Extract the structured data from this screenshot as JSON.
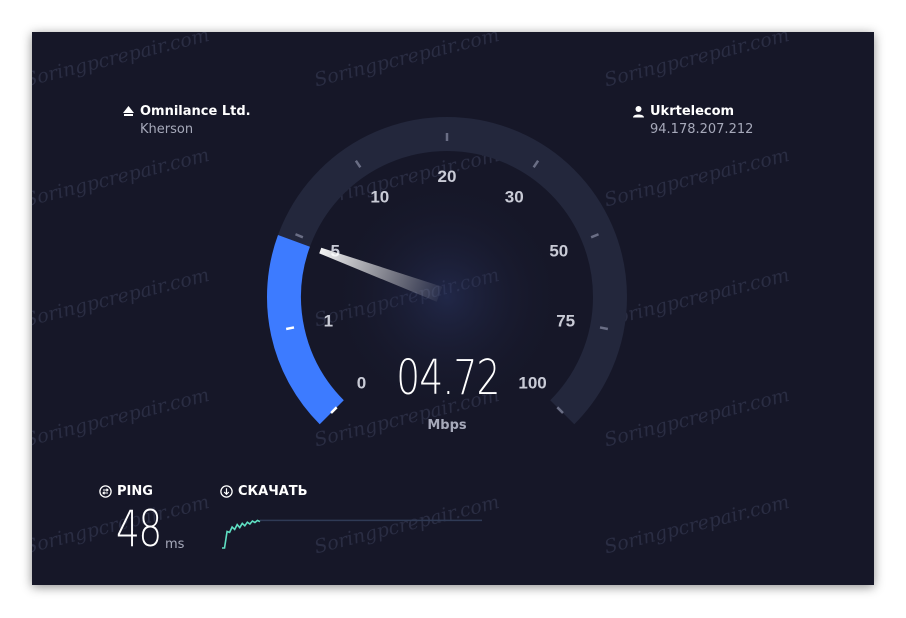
{
  "watermark": "Soringpcrepair.com",
  "server": {
    "name": "Omnilance Ltd.",
    "location": "Kherson",
    "icon": "server-icon"
  },
  "client": {
    "isp": "Ukrtelecom",
    "ip": "94.178.207.212",
    "icon": "user-icon"
  },
  "gauge": {
    "ticks": [
      "0",
      "1",
      "5",
      "10",
      "20",
      "30",
      "50",
      "75",
      "100"
    ],
    "current_value": 4.72,
    "value_text": "04.72",
    "unit": "Mbps",
    "colors": {
      "track": "#23273c",
      "fill": "#3d7bff",
      "needle": "#ffffff",
      "tick_label": "#c9cbd6"
    }
  },
  "ping": {
    "label": "PING",
    "value": "48",
    "unit": "ms",
    "icon": "ping-icon"
  },
  "download": {
    "label": "СКАЧАТЬ",
    "icon": "download-icon",
    "line_color": "#5fe0c3",
    "samples": [
      0,
      0,
      0.55,
      0.52,
      0.7,
      0.62,
      0.78,
      0.68,
      0.82,
      0.74,
      0.86,
      0.8,
      0.9,
      0.85,
      0.92,
      0.88
    ]
  }
}
